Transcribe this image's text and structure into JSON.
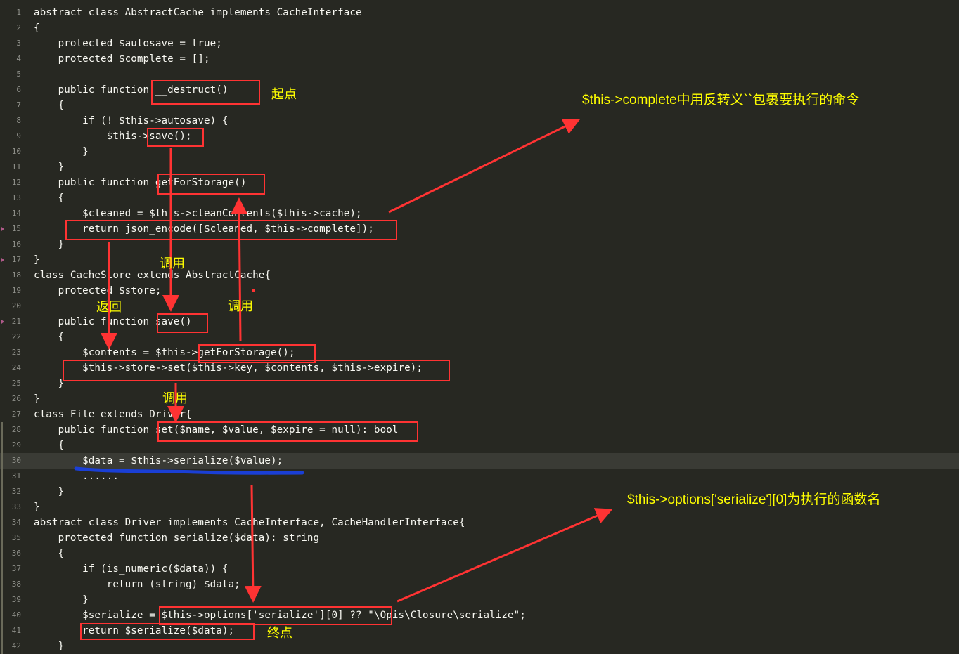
{
  "editor": {
    "lines": [
      {
        "n": "1",
        "code": "abstract class AbstractCache implements CacheInterface"
      },
      {
        "n": "2",
        "code": "{"
      },
      {
        "n": "3",
        "code": "    protected $autosave = true;"
      },
      {
        "n": "4",
        "code": "    protected $complete = [];"
      },
      {
        "n": "5",
        "code": ""
      },
      {
        "n": "6",
        "code": "    public function __destruct()"
      },
      {
        "n": "7",
        "code": "    {"
      },
      {
        "n": "8",
        "code": "        if (! $this->autosave) {"
      },
      {
        "n": "9",
        "code": "            $this->save();"
      },
      {
        "n": "10",
        "code": "        }"
      },
      {
        "n": "11",
        "code": "    }"
      },
      {
        "n": "12",
        "code": "    public function getForStorage()"
      },
      {
        "n": "13",
        "code": "    {"
      },
      {
        "n": "14",
        "code": "        $cleaned = $this->cleanContents($this->cache);"
      },
      {
        "n": "15",
        "code": "        return json_encode([$cleaned, $this->complete]);"
      },
      {
        "n": "16",
        "code": "    }"
      },
      {
        "n": "17",
        "code": "}"
      },
      {
        "n": "18",
        "code": "class CacheStore extends AbstractCache{"
      },
      {
        "n": "19",
        "code": "    protected $store;"
      },
      {
        "n": "20",
        "code": ""
      },
      {
        "n": "21",
        "code": "    public function save()"
      },
      {
        "n": "22",
        "code": "    {"
      },
      {
        "n": "23",
        "code": "        $contents = $this->getForStorage();"
      },
      {
        "n": "24",
        "code": "        $this->store->set($this->key, $contents, $this->expire);"
      },
      {
        "n": "25",
        "code": "    }"
      },
      {
        "n": "26",
        "code": "}"
      },
      {
        "n": "27",
        "code": "class File extends Driver{"
      },
      {
        "n": "28",
        "code": "    public function set($name, $value, $expire = null): bool"
      },
      {
        "n": "29",
        "code": "    {"
      },
      {
        "n": "30",
        "code": "        $data = $this->serialize($value);"
      },
      {
        "n": "31",
        "code": "        ......"
      },
      {
        "n": "32",
        "code": "    }"
      },
      {
        "n": "33",
        "code": "}"
      },
      {
        "n": "34",
        "code": "abstract class Driver implements CacheInterface, CacheHandlerInterface{"
      },
      {
        "n": "35",
        "code": "    protected function serialize($data): string"
      },
      {
        "n": "36",
        "code": "    {"
      },
      {
        "n": "37",
        "code": "        if (is_numeric($data)) {"
      },
      {
        "n": "38",
        "code": "            return (string) $data;"
      },
      {
        "n": "39",
        "code": "        }"
      },
      {
        "n": "40",
        "code": "        $serialize = $this->options['serialize'][0] ?? \"\\Opis\\Closure\\serialize\";"
      },
      {
        "n": "41",
        "code": "        return $serialize($data);"
      },
      {
        "n": "42",
        "code": "    }"
      }
    ]
  },
  "annotations": {
    "start_label": "起点",
    "end_label": "终点",
    "call_label_1": "调用",
    "call_label_2": "调用",
    "call_label_3": "调用",
    "return_label": "返回",
    "note_complete": "$this->complete中用反转义``包裹要执行的命令",
    "note_options": "$this->options['serialize'][0]为执行的函数名",
    "accent_color": "#ff3333",
    "label_color": "#ffff00",
    "underline_color": "#1a3fd6"
  }
}
